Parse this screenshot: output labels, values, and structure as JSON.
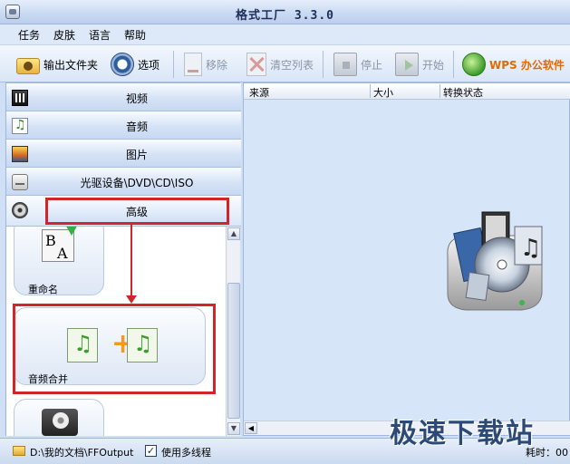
{
  "window": {
    "title": "格式工厂  3.3.0"
  },
  "menu": [
    "任务",
    "皮肤",
    "语言",
    "帮助"
  ],
  "toolbar": {
    "output_folder": "输出文件夹",
    "options": "选项",
    "remove": "移除",
    "clear_list": "清空列表",
    "stop": "停止",
    "start": "开始",
    "wps": "WPS 办公软件"
  },
  "sidebar": {
    "categories": [
      "视频",
      "音频",
      "图片",
      "光驱设备\\DVD\\CD\\ISO",
      "高级"
    ],
    "tools": [
      "重命名",
      "音频合并"
    ]
  },
  "list": {
    "columns": [
      "来源",
      "大小",
      "转换状态"
    ]
  },
  "status": {
    "path": "D:\\我的文档\\FFOutput",
    "multithread_label": "使用多线程",
    "multithread_checked": "✓",
    "time_label": "耗时：00"
  },
  "watermark": "极速下载站",
  "colors": {
    "highlight": "#d0262a",
    "accent": "#e36a00"
  }
}
